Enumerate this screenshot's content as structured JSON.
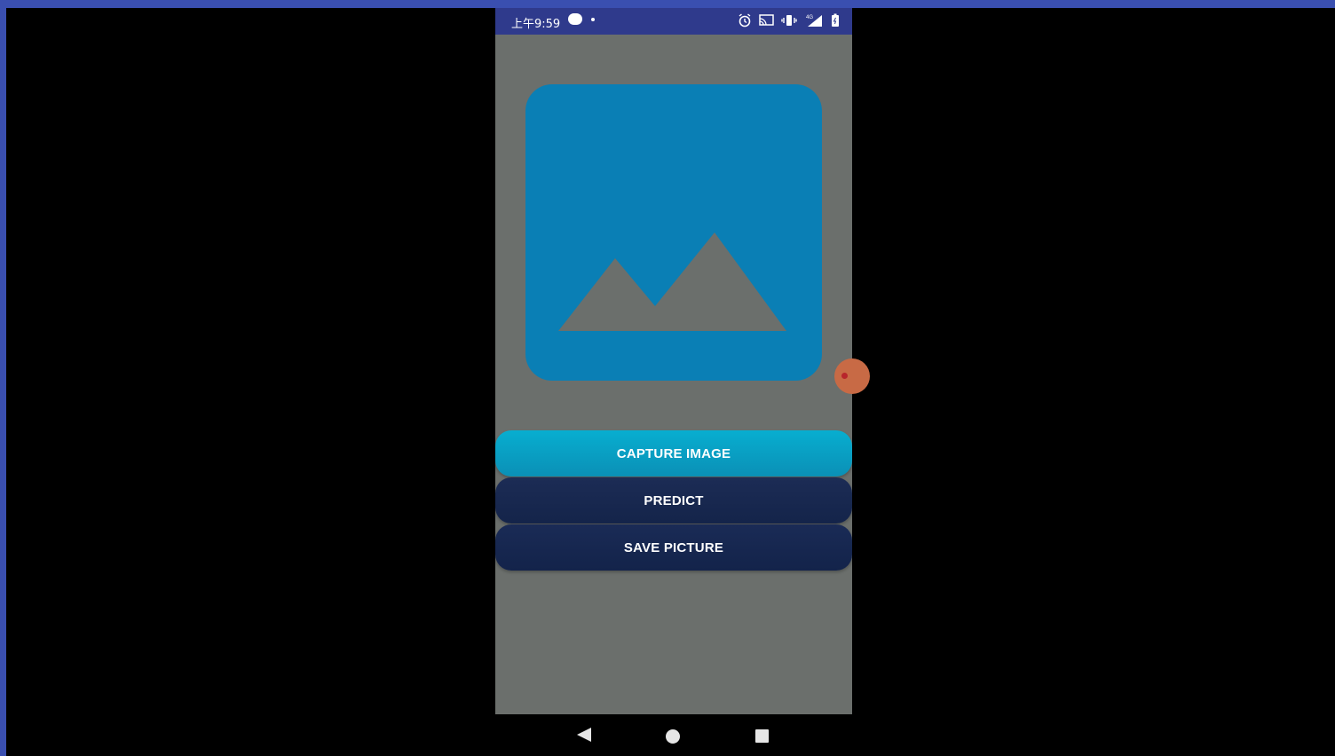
{
  "status_bar": {
    "time": "上午9:59",
    "icons": [
      "cloud-icon",
      "notification-dot-icon",
      "alarm-icon",
      "cast-icon",
      "vibrate-icon",
      "signal-4g-icon",
      "battery-icon"
    ]
  },
  "app": {
    "placeholder_icon": "image-placeholder-icon",
    "buttons": {
      "capture": "CAPTURE IMAGE",
      "predict": "PREDICT",
      "save": "SAVE PICTURE"
    }
  },
  "nav_bar": {
    "icons": [
      "back-icon",
      "home-icon",
      "recents-icon"
    ]
  },
  "colors": {
    "status_bar_bg": "#2f3a8c",
    "app_bg": "#6b6f6c",
    "placeholder_bg": "#0a7fb5",
    "capture_button": "#08aed0",
    "dark_button": "#16264d"
  }
}
